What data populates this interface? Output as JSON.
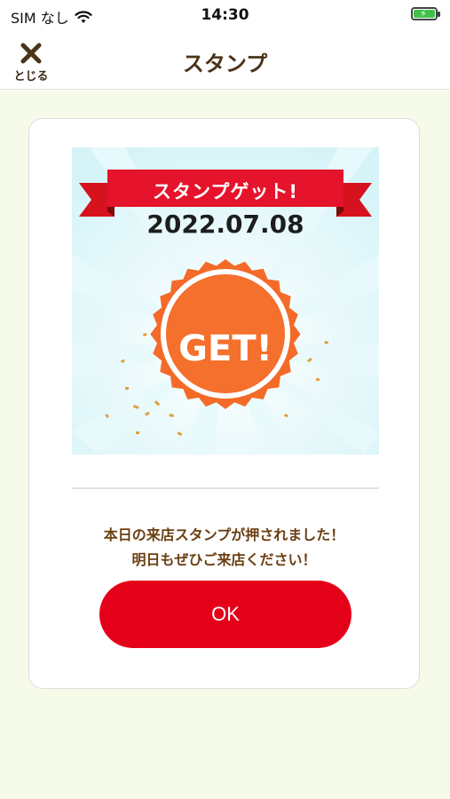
{
  "status_bar": {
    "carrier": "SIM なし",
    "time": "14:30",
    "wifi_icon": "wifi-icon",
    "battery_icon": "battery-charging-icon"
  },
  "nav": {
    "close_icon": "close-icon",
    "close_label": "とじる",
    "title": "スタンプ"
  },
  "stamp": {
    "ribbon_text": "スタンプゲット!",
    "date": "2022.07.08",
    "badge_text": "GET!"
  },
  "message": {
    "line1": "本日の来店スタンプが押されました！",
    "line2": "明日もぜひご来店ください！"
  },
  "ok_button": {
    "label": "OK"
  },
  "colors": {
    "background": "#f6fbe9",
    "accent_red": "#e5001a",
    "badge_orange": "#f46a28",
    "title_brown": "#4a3318",
    "message_brown": "#6b3e12"
  }
}
